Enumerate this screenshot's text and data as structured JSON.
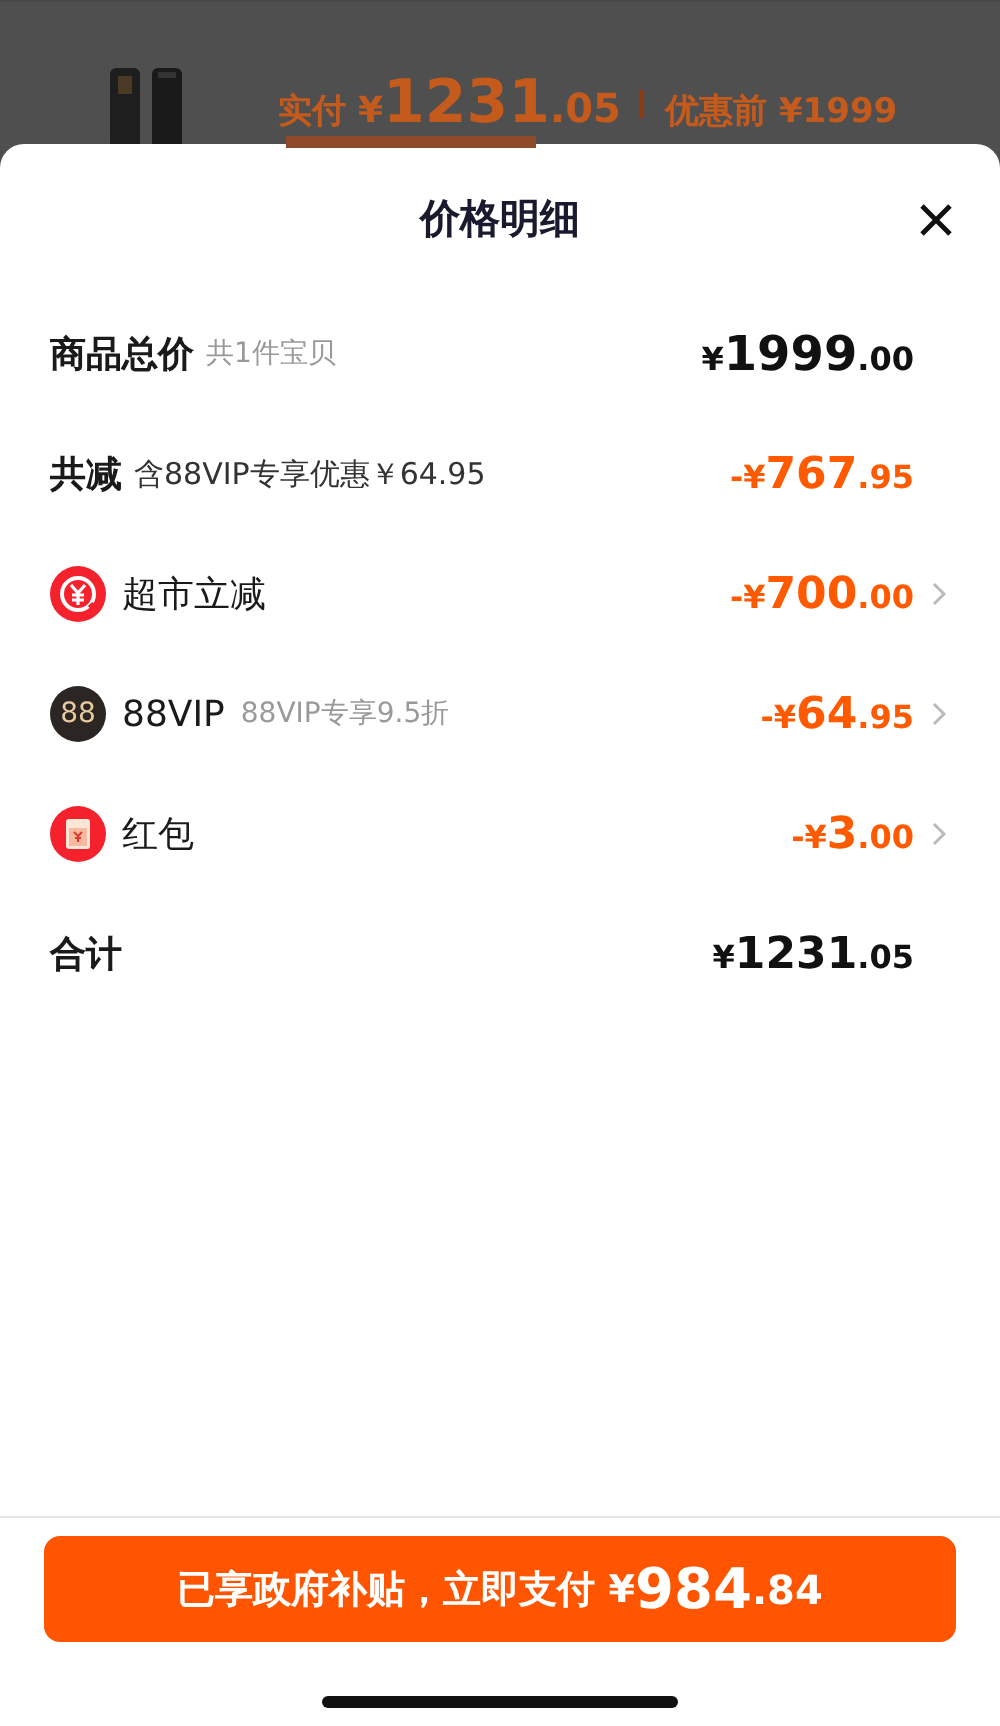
{
  "backdrop": {
    "paid_label": "实付",
    "paid_amount": "¥1231.05",
    "before_label": "优惠前",
    "before_amount": "¥1999"
  },
  "sheet": {
    "title": "价格明细",
    "rows": [
      {
        "kind": "total",
        "label": "商品总价",
        "note": "共1件宝贝",
        "amount": "¥1999.00"
      },
      {
        "kind": "reduction",
        "label": "共减",
        "note": "含88VIP专享优惠￥64.95",
        "amount": "-¥767.95"
      },
      {
        "kind": "store",
        "label": "超市立减",
        "amount": "-¥700.00"
      },
      {
        "kind": "vip",
        "label": "88VIP",
        "note": "88VIP专享9.5折",
        "amount": "-¥64.95",
        "icon_text": "88"
      },
      {
        "kind": "coupon",
        "label": "红包",
        "amount": "-¥3.00"
      },
      {
        "kind": "sum",
        "label": "合计",
        "amount": "¥1231.05"
      }
    ],
    "pay_button": {
      "label": "已享政府补贴，立即支付",
      "amount": "¥984.84"
    }
  }
}
